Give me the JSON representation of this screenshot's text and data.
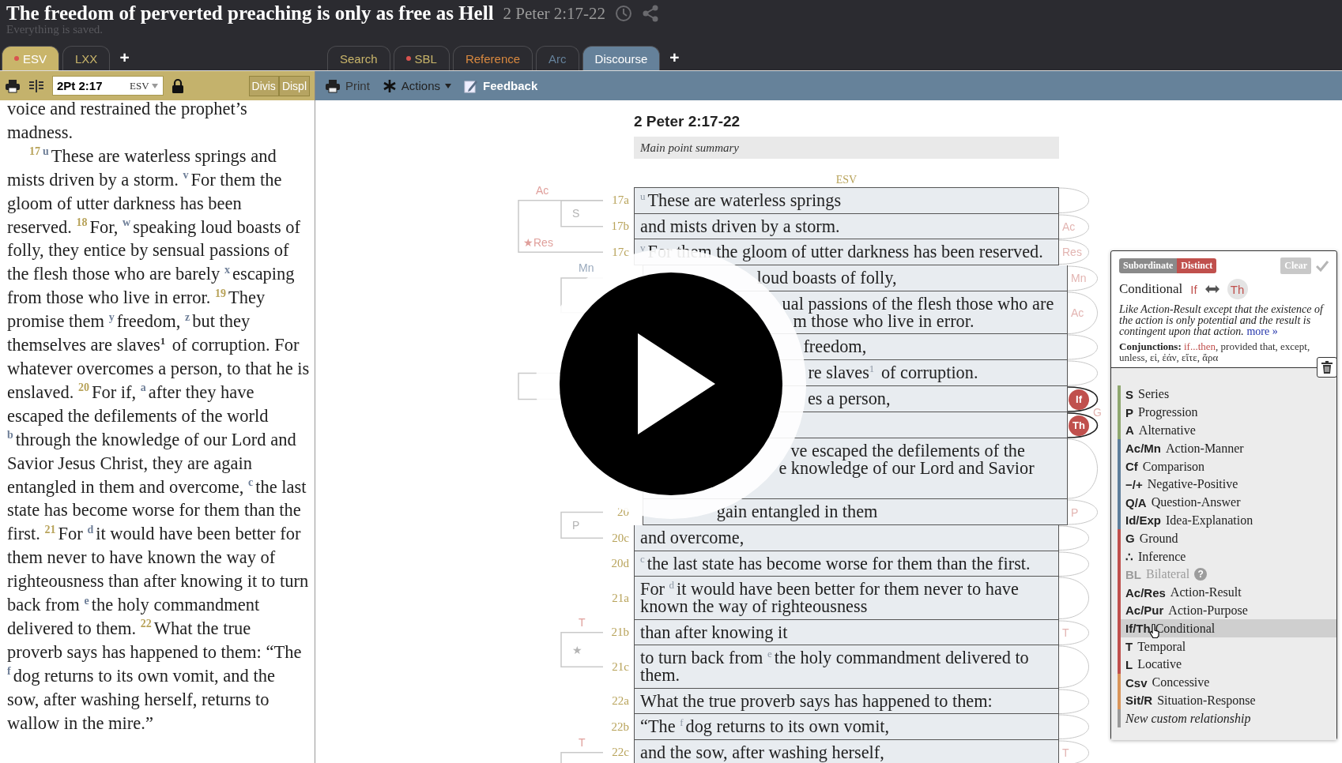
{
  "header": {
    "title": "The freedom of perverted preaching is only as free as Hell",
    "reference": "2 Peter 2:17-22",
    "status": "Everything is saved."
  },
  "left_tabs": [
    {
      "label": "ESV",
      "selected": true,
      "dot": true,
      "color": "#c9b56a"
    },
    {
      "label": "LXX",
      "selected": false,
      "dot": false,
      "color": "#c9b56a"
    }
  ],
  "left_add": "+",
  "right_tabs": [
    {
      "label": "Search",
      "selected": false,
      "dot": false,
      "color": "#c9b56a"
    },
    {
      "label": "SBL",
      "selected": false,
      "dot": true,
      "color": "#c9b56a"
    },
    {
      "label": "Reference",
      "selected": false,
      "dot": false,
      "color": "#d9893f"
    },
    {
      "label": "Arc",
      "selected": false,
      "dot": false,
      "color": "#65819a"
    },
    {
      "label": "Discourse",
      "selected": true,
      "dot": false,
      "color": "#65819a"
    }
  ],
  "right_add": "+",
  "passage_toolbar": {
    "reference": "2Pt 2:17",
    "version": "ESV",
    "buttons": [
      "Divis",
      "Displ"
    ]
  },
  "discourse_toolbar": {
    "buttons": [
      {
        "kind": "print",
        "label": "Print"
      },
      {
        "kind": "actions",
        "label": "Actions"
      },
      {
        "kind": "feedback",
        "label": "Feedback"
      }
    ]
  },
  "passage": {
    "paragraphs": [
      [
        {
          "kind": "text",
          "text": "voice and restrained the prophet’s madness."
        }
      ],
      [
        {
          "kind": "verse",
          "text": "17"
        },
        {
          "kind": "note",
          "text": "u"
        },
        {
          "kind": "text",
          "text": "These are waterless springs and mists driven by a storm. "
        },
        {
          "kind": "note",
          "text": "v"
        },
        {
          "kind": "text",
          "text": "For them the gloom of utter darkness has been reserved. "
        },
        {
          "kind": "verse",
          "text": "18"
        },
        {
          "kind": "text",
          "text": "For, "
        },
        {
          "kind": "note",
          "text": "w"
        },
        {
          "kind": "text",
          "text": "speaking loud boasts of folly, they entice by sensual passions of the flesh those who are barely "
        },
        {
          "kind": "note",
          "text": "x"
        },
        {
          "kind": "text",
          "text": "escaping from those who live in error. "
        },
        {
          "kind": "verse",
          "text": "19"
        },
        {
          "kind": "text",
          "text": "They promise them "
        },
        {
          "kind": "note",
          "text": "y"
        },
        {
          "kind": "text",
          "text": "freedom, "
        },
        {
          "kind": "note",
          "text": "z"
        },
        {
          "kind": "text",
          "text": "but they themselves are slaves"
        },
        {
          "kind": "footnote",
          "text": "1"
        },
        {
          "kind": "text",
          "text": " of corruption. For whatever overcomes a person, to that he is enslaved. "
        },
        {
          "kind": "verse",
          "text": "20"
        },
        {
          "kind": "text",
          "text": "For if, "
        },
        {
          "kind": "note",
          "text": "a"
        },
        {
          "kind": "text",
          "text": "after they have escaped the defilements of the world "
        },
        {
          "kind": "note",
          "text": "b"
        },
        {
          "kind": "text",
          "text": "through the knowledge of our Lord and Savior Jesus Christ, they are again entangled in them and overcome, "
        },
        {
          "kind": "note",
          "text": "c"
        },
        {
          "kind": "text",
          "text": "the last state has become worse for them than the first. "
        },
        {
          "kind": "verse",
          "text": "21"
        },
        {
          "kind": "text",
          "text": "For "
        },
        {
          "kind": "note",
          "text": "d"
        },
        {
          "kind": "text",
          "text": "it would have been better for them never to have known the way of righteousness than after knowing it to turn back from "
        },
        {
          "kind": "note",
          "text": "e"
        },
        {
          "kind": "text",
          "text": "the holy commandment delivered to them. "
        },
        {
          "kind": "verse",
          "text": "22"
        },
        {
          "kind": "text",
          "text": "What the true proverb says has happened to them: “The "
        },
        {
          "kind": "note",
          "text": "f"
        },
        {
          "kind": "text",
          "text": "dog returns to its own vomit, and the sow, after washing herself, returns to wallow in the mire.”"
        }
      ]
    ]
  },
  "discourse": {
    "heading": "2 Peter 2:17-22",
    "summary_placeholder": "Main point summary",
    "version": "ESV",
    "rows": [
      {
        "label": "17a",
        "kind": "text",
        "text": "$^{u}$These are waterless springs"
      },
      {
        "label": "17b",
        "kind": "text",
        "text": "and mists driven by a storm.",
        "arc_label": "Ac"
      },
      {
        "label": "17c",
        "kind": "text",
        "text": "$^{v}$For them the gloom of utter darkness has been reserved.",
        "arc_label": "Res"
      },
      {
        "kind": "covered",
        "lines": [
          "loud boasts of folly,"
        ],
        "arc_label": "Mn"
      },
      {
        "kind": "covered",
        "lines": [
          "ual passions of the flesh those who are",
          "m those who live in error."
        ],
        "arc_label": "Ac"
      },
      {
        "kind": "covered",
        "lines": [
          "freedom,"
        ]
      },
      {
        "kind": "covered",
        "lines": [
          "re slaves$^{1}$ of corruption."
        ]
      },
      {
        "kind": "covered",
        "lines": [
          "es a person,"
        ],
        "badge": "If"
      },
      {
        "kind": "covered",
        "badge": "Th",
        "arc_label": "G"
      },
      {
        "kind": "covered",
        "lines": [
          "ve escaped the defilements of the",
          "e knowledge of our Lord and Savior"
        ]
      },
      {
        "label": "20",
        "kind": "covered",
        "lines": [
          "gain entangled in them"
        ],
        "arc_label": "P"
      },
      {
        "label": "20c",
        "kind": "text",
        "text": "and overcome,"
      },
      {
        "label": "20d",
        "kind": "text",
        "text": "$^{c}$the last state has become worse for them than the first."
      },
      {
        "label": "21a",
        "kind": "text",
        "text": "For $^{d}$it would have been better for them never to have known the way of righteousness"
      },
      {
        "label": "21b",
        "kind": "text",
        "text": "than after knowing it",
        "arc_label": "T"
      },
      {
        "label": "21c",
        "kind": "text",
        "text": "to turn back from $^{e}$the holy commandment delivered to them."
      },
      {
        "label": "22a",
        "kind": "text",
        "text": "What the true proverb says has happened to them:"
      },
      {
        "label": "22b",
        "kind": "text",
        "text": "“The $^{f}$dog returns to its own vomit,"
      },
      {
        "label": "22c",
        "kind": "text",
        "text": "and the sow, after washing herself,",
        "arc_label": "T"
      }
    ],
    "bracket_labels": [
      {
        "text": "Ac",
        "color": "#e0a09c"
      },
      {
        "text": "S",
        "color": "#b4b4b4"
      },
      {
        "text": "★Res",
        "color": "#e0a09c"
      },
      {
        "text": "Mn",
        "color": "#9aaabd"
      },
      {
        "text": "P",
        "color": "#b4b4b4"
      },
      {
        "text": "T",
        "color": "#e0a09c"
      },
      {
        "text": "★",
        "color": "#b4b4b4"
      },
      {
        "text": "T",
        "color": "#e0a09c"
      }
    ]
  },
  "relationship_panel": {
    "tags": [
      {
        "label": "Subordinate",
        "color": "#8a8a8a"
      },
      {
        "label": "Distinct",
        "color": "#c0504d"
      }
    ],
    "clear": "Clear",
    "name": "Conditional",
    "pair": [
      "If",
      "Th"
    ],
    "description": "Like Action-Result except that the existence of the action is only potential and the result is contingent upon that action.",
    "more": "more »",
    "conjunctions": {
      "label": "Conjunctions:",
      "highlight": "if...then",
      "rest": ", provided that, except, unless, εἰ, ἐάν, εἴτε, ἄρα"
    },
    "items": [
      {
        "abbr": "S",
        "name": "Series",
        "color": "#8fa870",
        "selected": false,
        "disabled": false
      },
      {
        "abbr": "P",
        "name": "Progression",
        "color": "#8fa870",
        "selected": false,
        "disabled": false
      },
      {
        "abbr": "A",
        "name": "Alternative",
        "color": "#8fa870",
        "selected": false,
        "disabled": false
      },
      {
        "abbr": "Ac/Mn",
        "name": "Action-Manner",
        "color": "#5f7f9c",
        "selected": false,
        "disabled": false
      },
      {
        "abbr": "Cf",
        "name": "Comparison",
        "color": "#5f7f9c",
        "selected": false,
        "disabled": false
      },
      {
        "abbr": "−/+",
        "name": "Negative-Positive",
        "color": "#5f7f9c",
        "selected": false,
        "disabled": false
      },
      {
        "abbr": "Q/A",
        "name": "Question-Answer",
        "color": "#5f7f9c",
        "selected": false,
        "disabled": false
      },
      {
        "abbr": "Id/Exp",
        "name": "Idea-Explanation",
        "color": "#5f7f9c",
        "selected": false,
        "disabled": false
      },
      {
        "abbr": "G",
        "name": "Ground",
        "color": "#c0504d",
        "selected": false,
        "disabled": false
      },
      {
        "abbr": "∴",
        "name": "Inference",
        "color": "#c0504d",
        "selected": false,
        "disabled": false
      },
      {
        "abbr": "BL",
        "name": "Bilateral",
        "color": "#c0504d",
        "selected": false,
        "disabled": true,
        "help": "?"
      },
      {
        "abbr": "Ac/Res",
        "name": "Action-Result",
        "color": "#c0504d",
        "selected": false,
        "disabled": false
      },
      {
        "abbr": "Ac/Pur",
        "name": "Action-Purpose",
        "color": "#c0504d",
        "selected": false,
        "disabled": false
      },
      {
        "abbr": "If/Th",
        "name": "Conditional",
        "color": "#c0504d",
        "selected": true,
        "disabled": false
      },
      {
        "abbr": "T",
        "name": "Temporal",
        "color": "#c0504d",
        "selected": false,
        "disabled": false
      },
      {
        "abbr": "L",
        "name": "Locative",
        "color": "#c0504d",
        "selected": false,
        "disabled": false
      },
      {
        "abbr": "Csv",
        "name": "Concessive",
        "color": "#d9955a",
        "selected": false,
        "disabled": false
      },
      {
        "abbr": "Sit/R",
        "name": "Situation-Response",
        "color": "#d9955a",
        "selected": false,
        "disabled": false
      },
      {
        "kind": "custom",
        "name": "New custom relationship",
        "color": "#9a9a9a",
        "selected": false,
        "disabled": false
      }
    ]
  }
}
